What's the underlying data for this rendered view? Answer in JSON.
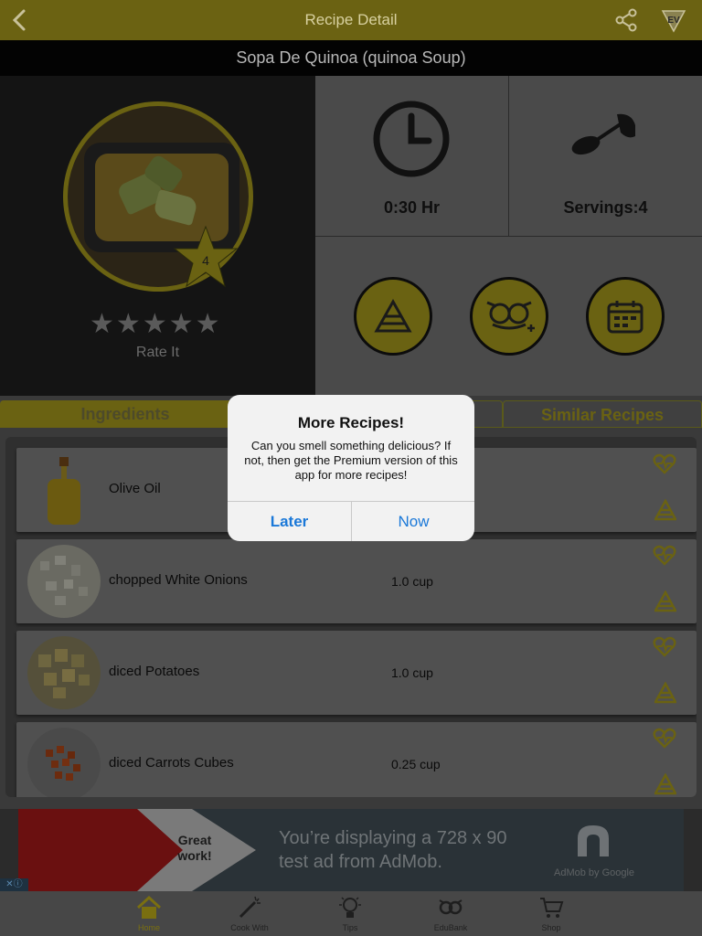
{
  "navbar": {
    "title": "Recipe Detail",
    "back_icon": "chevron-left-icon",
    "share_icon": "share-icon",
    "logo_icon": "app-logo-icon"
  },
  "recipe": {
    "title": "Sopa De Quinoa (quinoa Soup)",
    "difficulty_badge": "4",
    "rating": 0,
    "rating_max": 5,
    "rate_label": "Rate It",
    "time": "0:30 Hr",
    "servings": "Servings:4"
  },
  "actions": [
    {
      "name": "nutrition-pyramid-button",
      "icon": "pyramid-icon"
    },
    {
      "name": "add-to-cookbook-button",
      "icon": "owl-plus-icon"
    },
    {
      "name": "meal-plan-button",
      "icon": "calendar-icon"
    }
  ],
  "tabs": {
    "ingredients": "Ingredients",
    "similar": "Similar Recipes"
  },
  "ingredients": [
    {
      "name": "Olive Oil",
      "qty": ""
    },
    {
      "name": "chopped White Onions",
      "qty": "1.0 cup"
    },
    {
      "name": "diced Potatoes",
      "qty": "1.0 cup"
    },
    {
      "name": "diced Carrots Cubes",
      "qty": "0.25 cup"
    }
  ],
  "ad": {
    "badge": "Great work!",
    "line1": "You’re displaying a 728 x 90",
    "line2": "test ad from AdMob.",
    "by": "AdMob by Google"
  },
  "tabbar": [
    {
      "label": "Home",
      "icon": "home-icon",
      "active": true
    },
    {
      "label": "Cook With",
      "icon": "magic-wand-icon",
      "active": false
    },
    {
      "label": "Tips",
      "icon": "lightbulb-icon",
      "active": false
    },
    {
      "label": "EduBank",
      "icon": "owl-glasses-icon",
      "active": false
    },
    {
      "label": "Shop",
      "icon": "shopping-cart-icon",
      "active": false
    }
  ],
  "dialog": {
    "title": "More Recipes!",
    "message": "Can you smell something delicious? If not, then get the Premium version of this app for more recipes!",
    "later": "Later",
    "now": "Now"
  },
  "colors": {
    "accent": "#6a6212",
    "link_blue": "#1a78d8"
  }
}
